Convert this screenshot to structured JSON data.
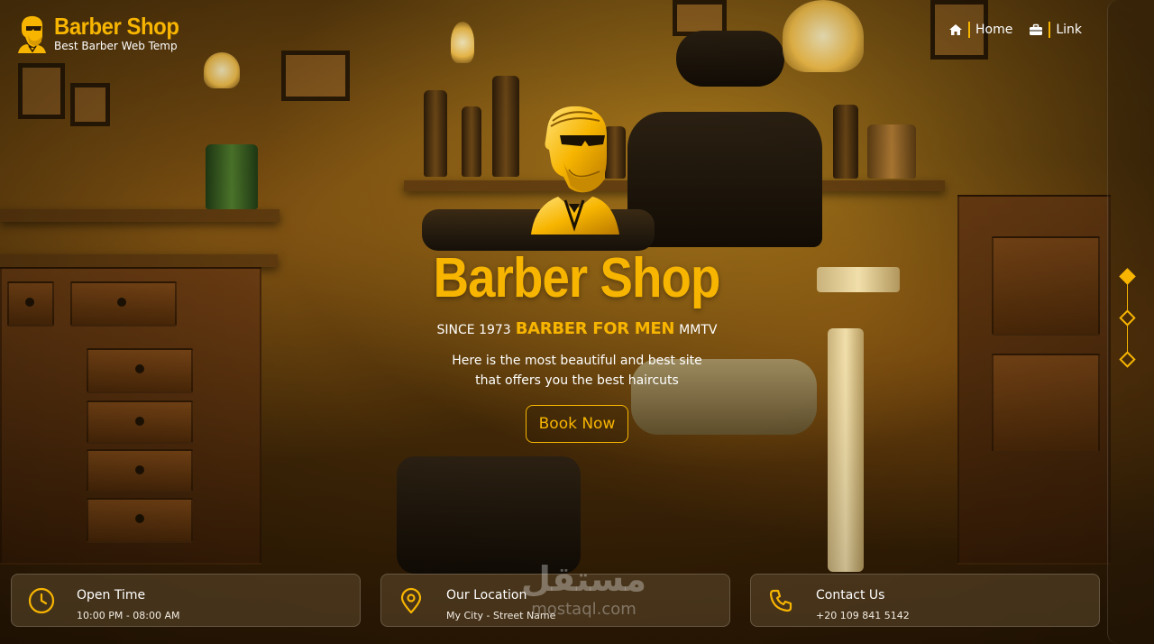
{
  "brand": {
    "title": "Barber Shop",
    "subtitle": "Best Barber Web Temp"
  },
  "nav": {
    "items": [
      {
        "label": "Home",
        "icon": "home-icon"
      },
      {
        "label": "Link",
        "icon": "briefcase-icon"
      }
    ]
  },
  "hero": {
    "title": "Barber Shop",
    "tagline_pre": "SINCE 1973",
    "tagline_highlight": "BARBER FOR MEN",
    "tagline_post": "MMTV",
    "description": "Here is the most beautiful and best site that offers you the best haircuts",
    "book_button": "Book Now"
  },
  "slider": {
    "active_index": 0,
    "count": 3
  },
  "cards": [
    {
      "title": "Open Time",
      "value": "10:00 PM - 08:00 AM",
      "icon": "clock-icon"
    },
    {
      "title": "Our Location",
      "value": "My City - Street Name",
      "icon": "location-pin-icon"
    },
    {
      "title": "Contact Us",
      "value": "+20 109 841 5142",
      "icon": "phone-icon"
    }
  ],
  "watermark": {
    "arabic": "مستقل",
    "latin": "mostaql.com"
  },
  "colors": {
    "accent": "#f7b500",
    "text": "#ffffff"
  }
}
